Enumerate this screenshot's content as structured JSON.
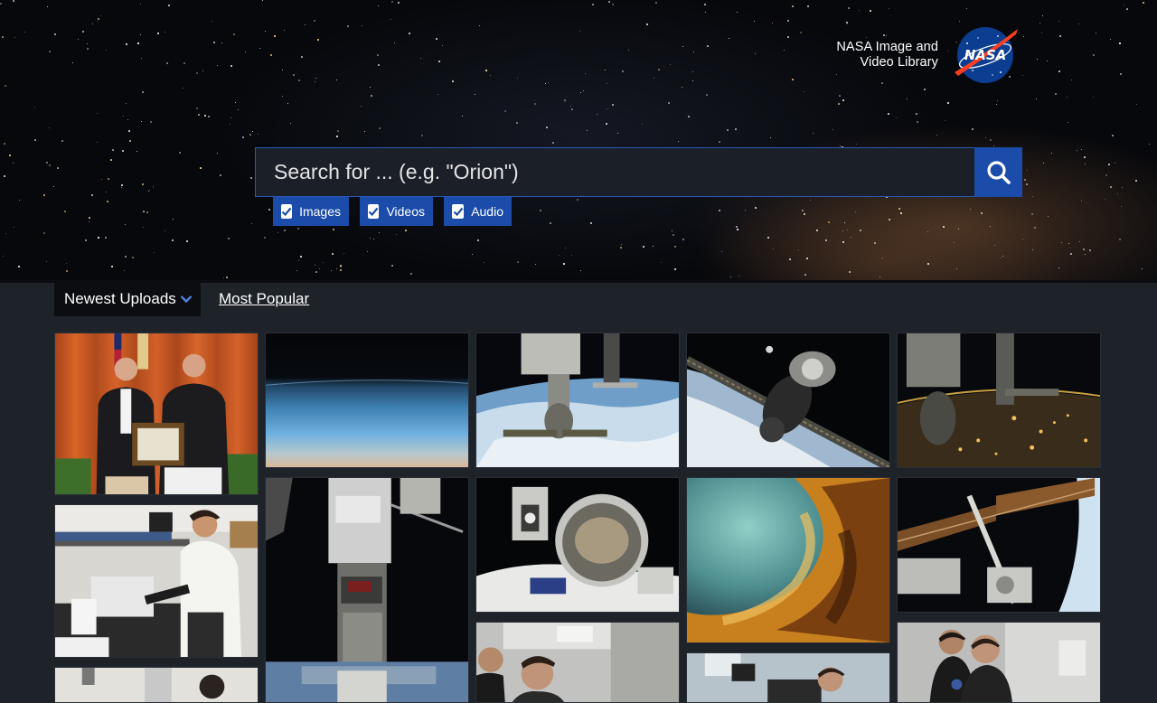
{
  "brand": {
    "line1": "NASA Image and",
    "line2": "Video Library",
    "logo_text": "NASA",
    "logo_icon": "nasa-meatball-logo"
  },
  "search": {
    "placeholder": "Search for ... (e.g. \"Orion\")",
    "value": "",
    "button_icon": "search-icon"
  },
  "filters": [
    {
      "label": "Images",
      "checked": true
    },
    {
      "label": "Videos",
      "checked": true
    },
    {
      "label": "Audio",
      "checked": true
    }
  ],
  "sort": {
    "selected": "Newest Uploads",
    "alternate": "Most Popular"
  },
  "colors": {
    "accent": "#1c4ca9",
    "page_bg": "#1e2229",
    "hero_bg": "#07080c"
  },
  "gallery": {
    "tiles": [
      {
        "subject": "award-ceremony-photo"
      },
      {
        "subject": "earth-limb-photo"
      },
      {
        "subject": "iss-soyuz-over-earth-photo"
      },
      {
        "subject": "spacecraft-docking-photo"
      },
      {
        "subject": "iss-night-city-lights-photo"
      },
      {
        "subject": "laboratory-scientist-photo"
      },
      {
        "subject": "iss-module-photo"
      },
      {
        "subject": "astronaut-spacewalk-selfie-photo"
      },
      {
        "subject": "nebula-photo"
      },
      {
        "subject": "iss-solar-array-photo"
      },
      {
        "subject": "lab-workers-photo"
      },
      {
        "subject": "lab-worker-photo"
      },
      {
        "subject": "lab-equipment-photo"
      },
      {
        "subject": "lab-engineers-photo"
      }
    ]
  }
}
